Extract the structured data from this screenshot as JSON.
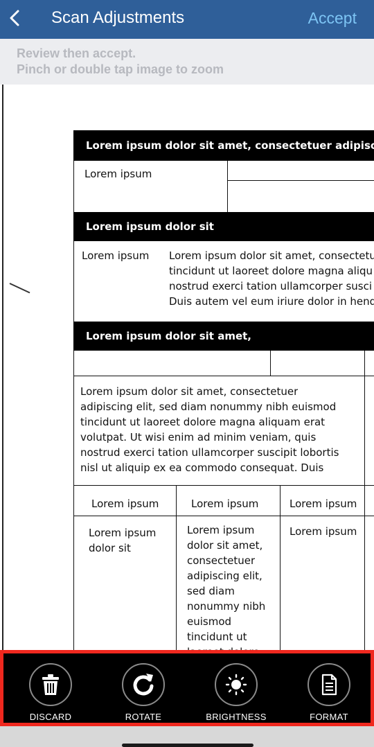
{
  "header": {
    "back_icon": "chevron-left-icon",
    "title": "Scan Adjustments",
    "accept_label": "Accept"
  },
  "hint": {
    "line1": "Review then accept.",
    "line2": "Pinch or double tap image to zoom"
  },
  "document": {
    "bar1": "Lorem ipsum dolor sit amet, consectetuer adipiscing eli",
    "cell1": "Lorem ipsum",
    "bar2": "Lorem ipsum dolor sit",
    "row2_label": "Lorem ipsum",
    "row2_lines": [
      "Lorem ipsum dolor sit amet, consectetu",
      "tincidunt ut laoreet dolore magna aliqu",
      "nostrud exerci tation ullamcorper susci",
      "Duis autem vel eum iriure dolor in hend"
    ],
    "bar3": "Lorem ipsum dolor sit amet,",
    "para_lines": [
      "Lorem ipsum dolor sit amet, consectetuer",
      "adipiscing elit, sed diam nonummy nibh euismod",
      "tincidunt ut laoreet dolore magna aliquam erat",
      "volutpat. Ut wisi enim ad minim veniam, quis",
      "nostrud exerci tation ullamcorper suscipit lobortis",
      "nisl ut aliquip ex ea commodo consequat. Duis"
    ],
    "col_headers": [
      "Lorem ipsum",
      "Lorem ipsum",
      "Lorem ipsum"
    ],
    "col1_lines": [
      "Lorem ipsum",
      "dolor sit"
    ],
    "col2_lines": [
      "Lorem ipsum",
      "dolor sit amet,",
      "consectetuer",
      "adipiscing elit,",
      "sed diam",
      "nonummy nibh",
      "euismod",
      "tincidunt ut",
      "laoreet dolore"
    ],
    "col3_lines": [
      "Lorem ipsum"
    ]
  },
  "toolbar": {
    "discard_label": "DISCARD",
    "rotate_label": "ROTATE",
    "brightness_label": "BRIGHTNESS",
    "format_label": "FORMAT"
  },
  "colors": {
    "nav": "#2f5f99",
    "accept": "#7dc4f4",
    "highlight": "#f0281e"
  }
}
